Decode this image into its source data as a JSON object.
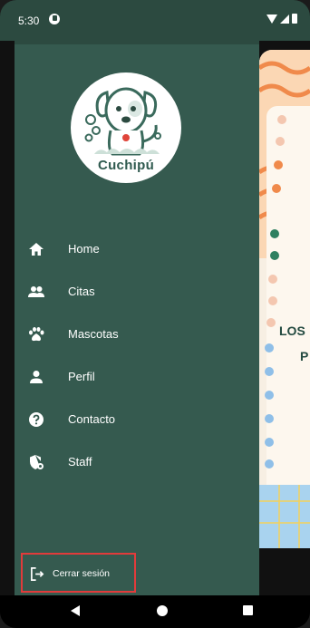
{
  "status_bar": {
    "time": "5:30"
  },
  "app": {
    "name": "Cuchipú"
  },
  "menu": {
    "items": [
      {
        "label": "Home",
        "icon": "home-icon"
      },
      {
        "label": "Citas",
        "icon": "people-icon"
      },
      {
        "label": "Mascotas",
        "icon": "paw-icon"
      },
      {
        "label": "Perfil",
        "icon": "person-icon"
      },
      {
        "label": "Contacto",
        "icon": "help-icon"
      },
      {
        "label": "Staff",
        "icon": "shield-icon"
      }
    ]
  },
  "logout": {
    "label": "Cerrar sesión",
    "icon": "logout-icon"
  },
  "background": {
    "text1": "LOS",
    "text2": "P"
  },
  "colors": {
    "drawer": "#355a4f",
    "status_bar": "#2c4a40",
    "logo_text": "#2f5a4f",
    "highlight": "#e23b3b"
  }
}
